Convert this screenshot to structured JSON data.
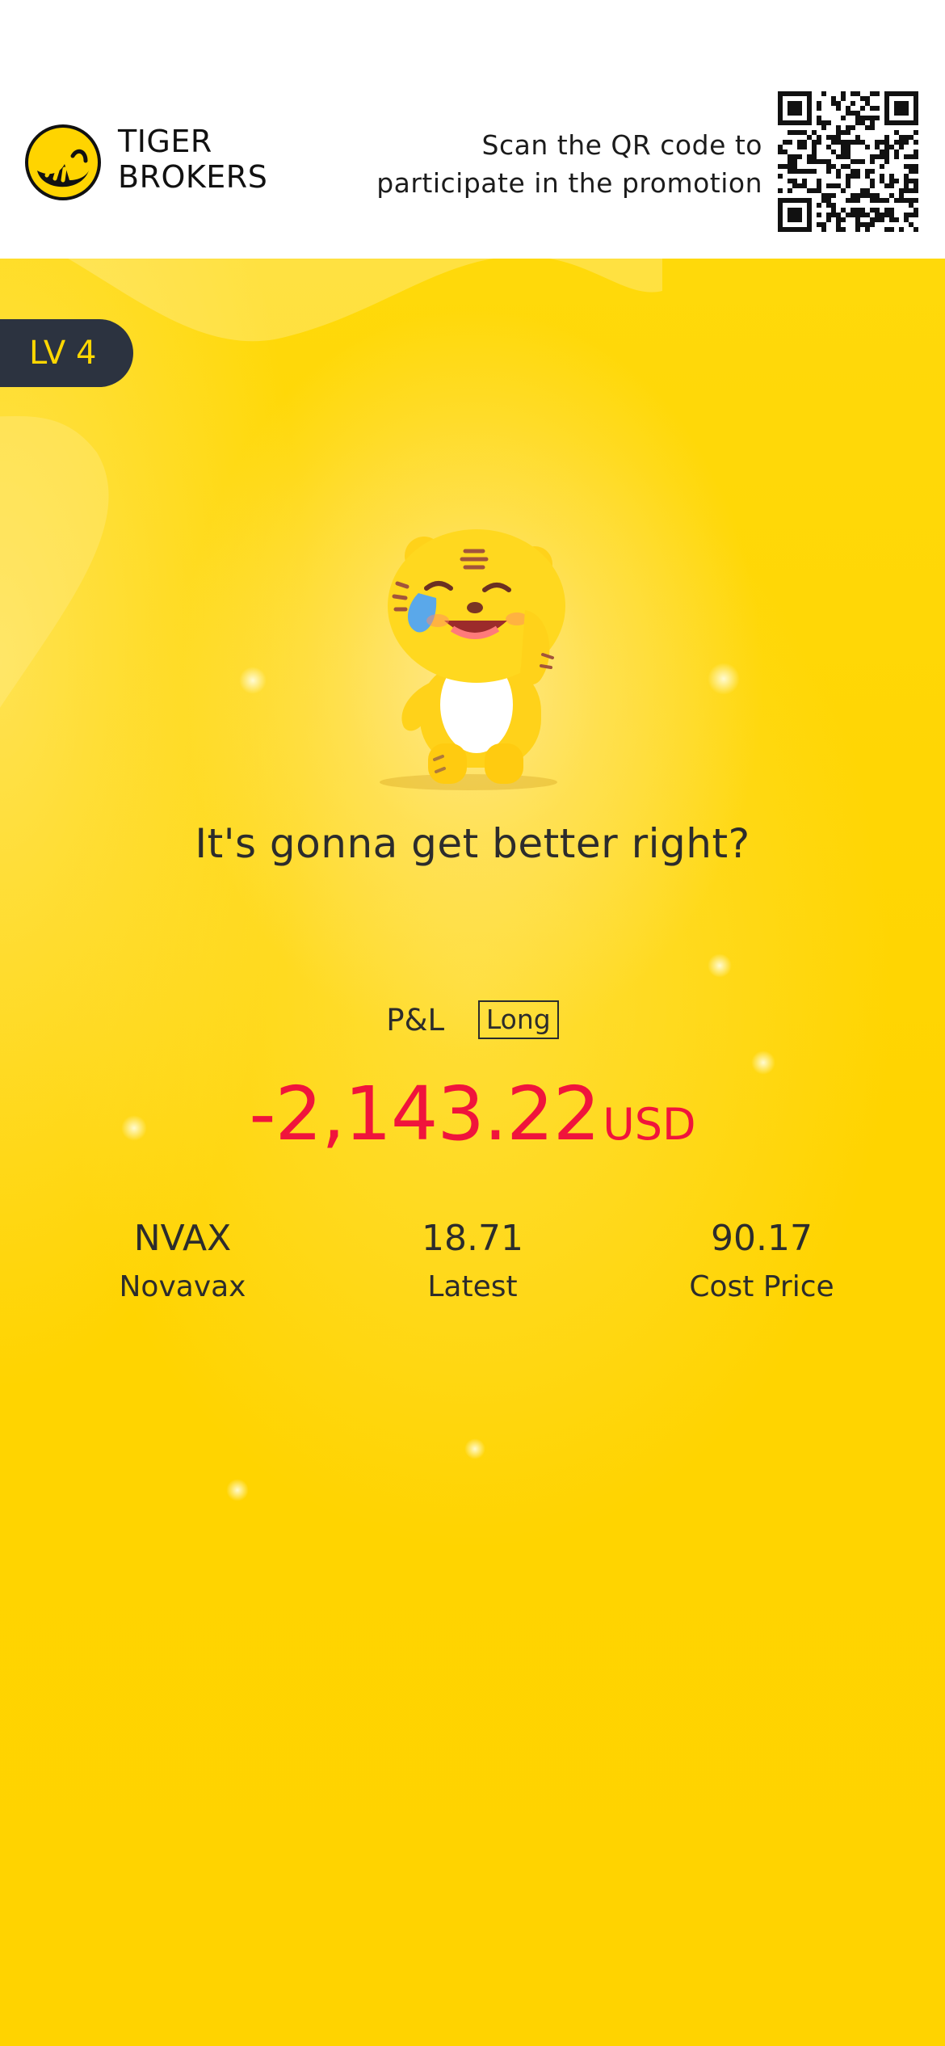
{
  "header": {
    "brand_line1": "TIGER",
    "brand_line2": "BROKERS",
    "promo_line1": "Scan the QR code to",
    "promo_line2": "participate in the promotion"
  },
  "badge": {
    "level": "LV 4"
  },
  "mascot": {
    "icon": "crying-laughing-tiger-mascot"
  },
  "message": "It's gonna get better right?",
  "pnl": {
    "label": "P&L",
    "tag": "Long",
    "value": "-2,143.22",
    "unit": "USD",
    "color": "#f0143c"
  },
  "stats": [
    {
      "value": "NVAX",
      "label": "Novavax"
    },
    {
      "value": "18.71",
      "label": "Latest"
    },
    {
      "value": "90.17",
      "label": "Cost Price"
    }
  ],
  "colors": {
    "accent": "#ffd400",
    "badge_bg": "#2c3340",
    "badge_text": "#ffd700",
    "text": "#2c2c2c"
  }
}
